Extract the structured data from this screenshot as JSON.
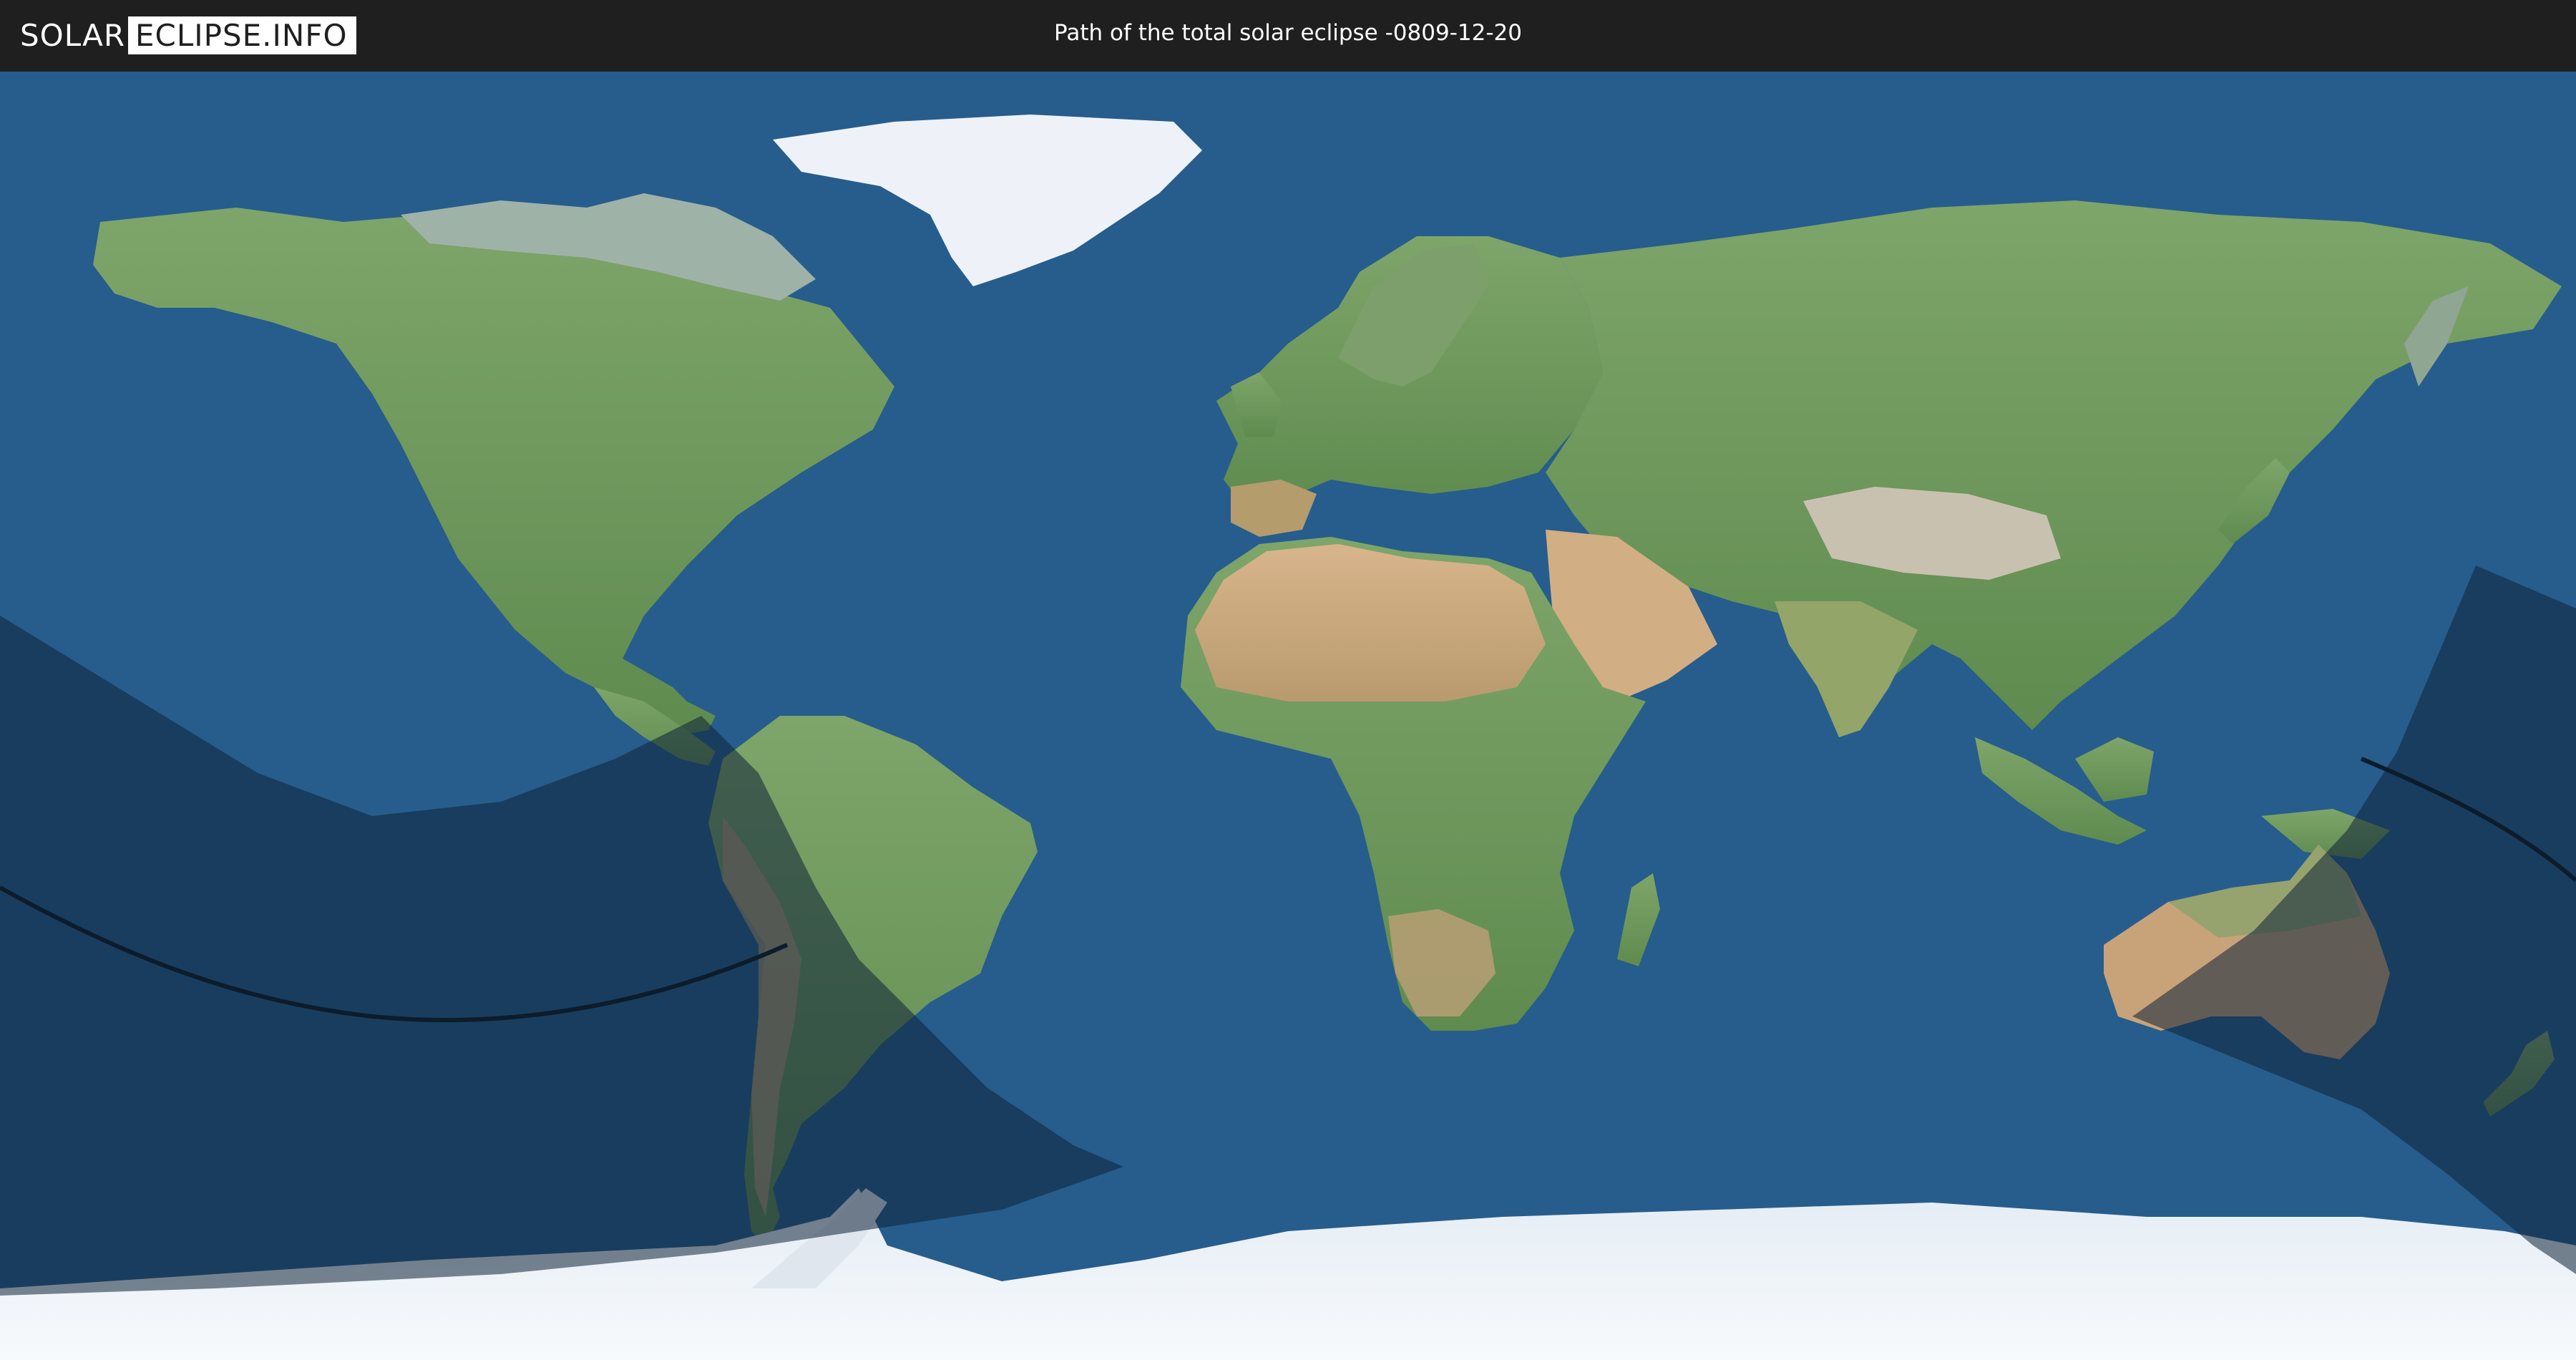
{
  "header": {
    "logo_left": "SOLAR",
    "logo_right": "ECLIPSE.INFO",
    "title": "Path of the total solar eclipse -0809-12-20"
  },
  "colors": {
    "header_bg": "#1f1f1f",
    "ocean": "#265d8c",
    "land_green": "#6f9a5e",
    "land_desert": "#c9a37a",
    "ice": "#eef3f8",
    "penumbra": "#122a44",
    "central_line": "#0d1c2b"
  }
}
